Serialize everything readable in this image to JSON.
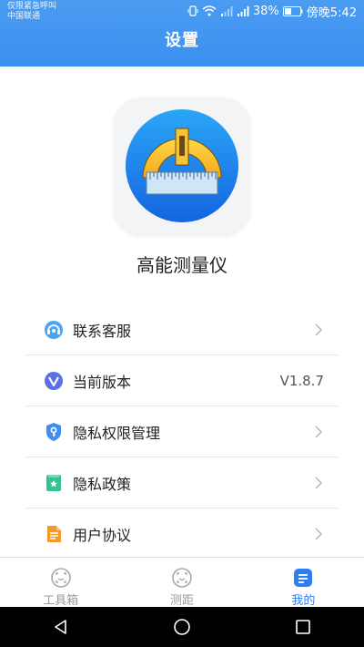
{
  "status_bar": {
    "carrier_line1": "仅限紧急呼叫",
    "carrier_line2": "中国联通",
    "battery": "38%",
    "time": "傍晚5:42"
  },
  "header": {
    "title": "设置"
  },
  "app": {
    "name": "高能测量仪"
  },
  "menu": [
    {
      "label": "联系客服",
      "icon": "headset-icon",
      "value": ""
    },
    {
      "label": "当前版本",
      "icon": "version-v-icon",
      "value": "V1.8.7"
    },
    {
      "label": "隐私权限管理",
      "icon": "shield-key-icon",
      "value": ""
    },
    {
      "label": "隐私政策",
      "icon": "bookmark-star-icon",
      "value": ""
    },
    {
      "label": "用户协议",
      "icon": "document-icon",
      "value": ""
    }
  ],
  "tabs": [
    {
      "label": "工具箱",
      "icon": "face-scan-icon",
      "active": false
    },
    {
      "label": "测距",
      "icon": "face-scan-icon",
      "active": false
    },
    {
      "label": "我的",
      "icon": "menu-square-icon",
      "active": true
    }
  ],
  "colors": {
    "header": "#3c8ff0",
    "accent": "#2f7ef0",
    "text": "#222222",
    "muted": "#9a9a9a"
  }
}
